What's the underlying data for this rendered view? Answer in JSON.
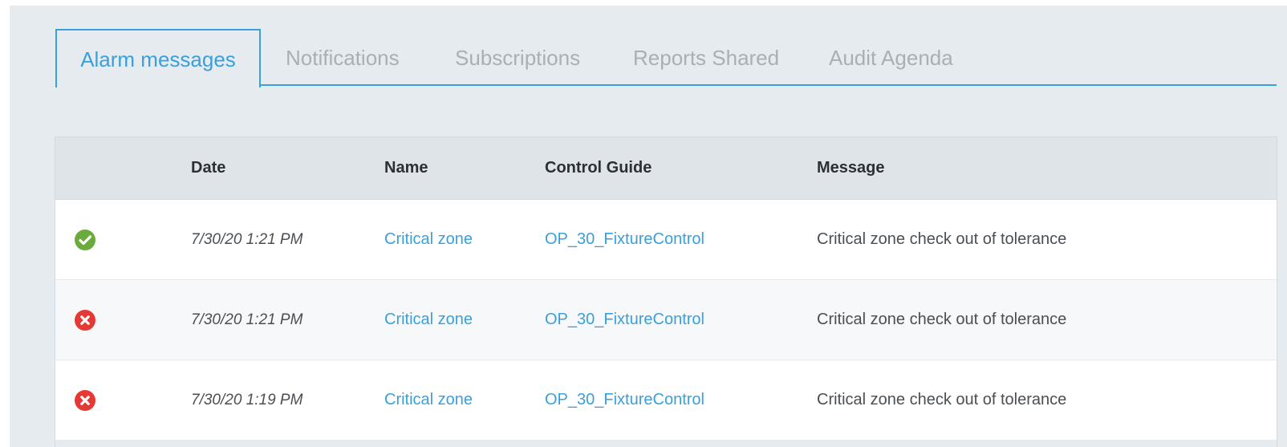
{
  "tabs": [
    {
      "label": "Alarm messages",
      "active": true
    },
    {
      "label": "Notifications",
      "active": false
    },
    {
      "label": "Subscriptions",
      "active": false
    },
    {
      "label": "Reports Shared",
      "active": false
    },
    {
      "label": "Audit Agenda",
      "active": false
    }
  ],
  "table": {
    "columns": {
      "status": "",
      "date": "Date",
      "name": "Name",
      "control_guide": "Control Guide",
      "message": "Message"
    },
    "rows": [
      {
        "status": "success",
        "status_icon": "check-circle-icon",
        "date": "7/30/20 1:21 PM",
        "name": "Critical zone",
        "control_guide": "OP_30_FixtureControl",
        "message": "Critical zone check out of tolerance"
      },
      {
        "status": "error",
        "status_icon": "x-circle-icon",
        "date": "7/30/20 1:21 PM",
        "name": "Critical zone",
        "control_guide": "OP_30_FixtureControl",
        "message": "Critical zone check out of tolerance"
      },
      {
        "status": "error",
        "status_icon": "x-circle-icon",
        "date": "7/30/20 1:19 PM",
        "name": "Critical zone",
        "control_guide": "OP_30_FixtureControl",
        "message": "Critical zone check out of tolerance"
      }
    ]
  },
  "colors": {
    "accent": "#3aa0db",
    "success": "#6aab3c",
    "error": "#e53935",
    "inactive_tab": "#a7afb7"
  }
}
